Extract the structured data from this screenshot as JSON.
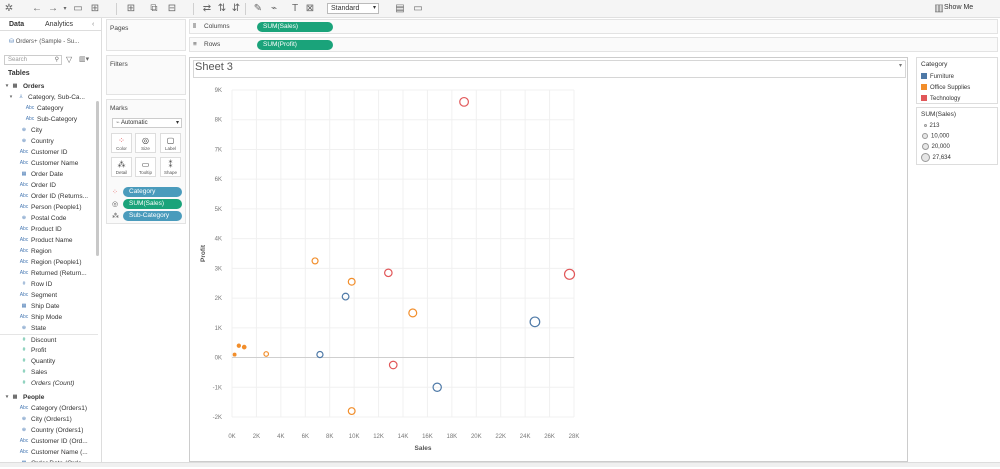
{
  "toolbar": {
    "mark_type_select": "Standard",
    "show_me_label": "Show Me"
  },
  "left_pane": {
    "tab_data": "Data",
    "tab_analytics": "Analytics",
    "data_source": "Orders+ (Sample - Su...",
    "search_placeholder": "Search",
    "tables_heading": "Tables",
    "orders_group": "Orders",
    "people_group": "People",
    "orders_fields": [
      {
        "label": "Category, Sub-Ca...",
        "icon": "hierarchy-icon",
        "kind": "dim"
      },
      {
        "label": "Category",
        "icon": "abc-icon",
        "kind": "dim"
      },
      {
        "label": "Sub-Category",
        "icon": "abc-icon",
        "kind": "dim"
      },
      {
        "label": "City",
        "icon": "globe-icon",
        "kind": "dim"
      },
      {
        "label": "Country",
        "icon": "globe-icon",
        "kind": "dim"
      },
      {
        "label": "Customer ID",
        "icon": "abc-icon",
        "kind": "dim"
      },
      {
        "label": "Customer Name",
        "icon": "abc-icon",
        "kind": "dim"
      },
      {
        "label": "Order Date",
        "icon": "calendar-icon",
        "kind": "dim"
      },
      {
        "label": "Order ID",
        "icon": "abc-icon",
        "kind": "dim"
      },
      {
        "label": "Order ID (Returns...",
        "icon": "abc-icon",
        "kind": "dim"
      },
      {
        "label": "Person (People1)",
        "icon": "abc-icon",
        "kind": "dim"
      },
      {
        "label": "Postal Code",
        "icon": "globe-icon",
        "kind": "dim"
      },
      {
        "label": "Product ID",
        "icon": "abc-icon",
        "kind": "dim"
      },
      {
        "label": "Product Name",
        "icon": "abc-icon",
        "kind": "dim"
      },
      {
        "label": "Region",
        "icon": "abc-icon",
        "kind": "dim"
      },
      {
        "label": "Region (People1)",
        "icon": "abc-icon",
        "kind": "dim"
      },
      {
        "label": "Returned (Return...",
        "icon": "abc-icon",
        "kind": "dim"
      },
      {
        "label": "Row ID",
        "icon": "hash-icon",
        "kind": "dim"
      },
      {
        "label": "Segment",
        "icon": "abc-icon",
        "kind": "dim"
      },
      {
        "label": "Ship Date",
        "icon": "calendar-icon",
        "kind": "dim"
      },
      {
        "label": "Ship Mode",
        "icon": "abc-icon",
        "kind": "dim"
      },
      {
        "label": "State",
        "icon": "globe-icon",
        "kind": "dim"
      },
      {
        "label": "Discount",
        "icon": "hash-icon",
        "kind": "meas"
      },
      {
        "label": "Profit",
        "icon": "hash-icon",
        "kind": "meas"
      },
      {
        "label": "Quantity",
        "icon": "hash-icon",
        "kind": "meas"
      },
      {
        "label": "Sales",
        "icon": "hash-icon",
        "kind": "meas"
      },
      {
        "label": "Orders (Count)",
        "icon": "hash-icon",
        "kind": "meas"
      }
    ],
    "people_fields": [
      {
        "label": "Category (Orders1)",
        "icon": "abc-icon",
        "kind": "dim"
      },
      {
        "label": "City (Orders1)",
        "icon": "globe-icon",
        "kind": "dim"
      },
      {
        "label": "Country (Orders1)",
        "icon": "globe-icon",
        "kind": "dim"
      },
      {
        "label": "Customer ID (Ord...",
        "icon": "abc-icon",
        "kind": "dim"
      },
      {
        "label": "Customer Name (...",
        "icon": "abc-icon",
        "kind": "dim"
      },
      {
        "label": "Order Date (Orde...",
        "icon": "calendar-icon",
        "kind": "dim"
      }
    ]
  },
  "shelves": {
    "pages_label": "Pages",
    "filters_label": "Filters",
    "columns_label": "Columns",
    "rows_label": "Rows",
    "columns_pill": "SUM(Sales)",
    "rows_pill": "SUM(Profit)"
  },
  "marks": {
    "title": "Marks",
    "mark_type": "Automatic",
    "buttons": [
      "Color",
      "Size",
      "Label",
      "Detail",
      "Tooltip",
      "Shape"
    ],
    "pills": [
      "Category",
      "SUM(Sales)",
      "Sub-Category"
    ]
  },
  "sheet": {
    "title": "Sheet 3"
  },
  "legend": {
    "category_title": "Category",
    "categories": [
      {
        "name": "Furniture",
        "color": "#4e79a7"
      },
      {
        "name": "Office Supplies",
        "color": "#f28e2b"
      },
      {
        "name": "Technology",
        "color": "#e15759"
      }
    ],
    "size_title": "SUM(Sales)",
    "size_items": [
      "213",
      "10,000",
      "20,000",
      "27,634"
    ]
  },
  "chart_data": {
    "type": "scatter",
    "title": "",
    "xlabel": "Sales",
    "ylabel": "Profit",
    "xlim": [
      0,
      28000
    ],
    "ylim": [
      -2000,
      9000
    ],
    "x_ticks": [
      "0K",
      "2K",
      "4K",
      "6K",
      "8K",
      "10K",
      "12K",
      "14K",
      "16K",
      "18K",
      "20K",
      "22K",
      "24K",
      "26K",
      "28K"
    ],
    "y_ticks": [
      "-2K",
      "-1K",
      "0K",
      "1K",
      "2K",
      "3K",
      "4K",
      "5K",
      "6K",
      "7K",
      "8K",
      "9K"
    ],
    "size_encodes": "SUM(Sales)",
    "points": [
      {
        "category": "Technology",
        "x": 19000,
        "y": 8600
      },
      {
        "category": "Technology",
        "x": 27634,
        "y": 2800
      },
      {
        "category": "Technology",
        "x": 12800,
        "y": 2850
      },
      {
        "category": "Technology",
        "x": 13200,
        "y": -250
      },
      {
        "category": "Office Supplies",
        "x": 6800,
        "y": 3250
      },
      {
        "category": "Office Supplies",
        "x": 9800,
        "y": 2550
      },
      {
        "category": "Office Supplies",
        "x": 14800,
        "y": 1500
      },
      {
        "category": "Office Supplies",
        "x": 2800,
        "y": 120
      },
      {
        "category": "Office Supplies",
        "x": 560,
        "y": 400
      },
      {
        "category": "Office Supplies",
        "x": 1000,
        "y": 350
      },
      {
        "category": "Office Supplies",
        "x": 213,
        "y": 100
      },
      {
        "category": "Office Supplies",
        "x": 9800,
        "y": -1800
      },
      {
        "category": "Furniture",
        "x": 9300,
        "y": 2050
      },
      {
        "category": "Furniture",
        "x": 7200,
        "y": 100
      },
      {
        "category": "Furniture",
        "x": 24800,
        "y": 1200
      },
      {
        "category": "Furniture",
        "x": 16800,
        "y": -1000
      }
    ]
  }
}
